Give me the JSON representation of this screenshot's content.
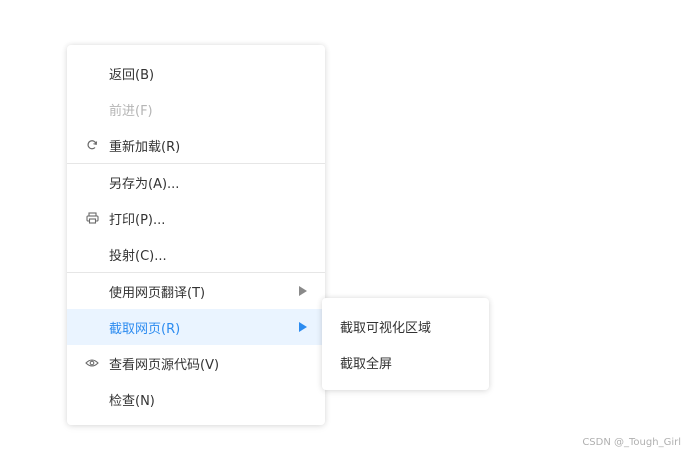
{
  "context_menu": {
    "items": [
      {
        "label": "返回(B)",
        "icon": null,
        "disabled": false
      },
      {
        "label": "前进(F)",
        "icon": null,
        "disabled": true
      },
      {
        "label": "重新加载(R)",
        "icon": "reload-icon",
        "disabled": false
      },
      {
        "label": "另存为(A)...",
        "icon": null,
        "disabled": false
      },
      {
        "label": "打印(P)...",
        "icon": "printer-icon",
        "disabled": false
      },
      {
        "label": "投射(C)...",
        "icon": null,
        "disabled": false
      },
      {
        "label": "使用网页翻译(T)",
        "icon": null,
        "has_submenu": true
      },
      {
        "label": "截取网页(R)",
        "icon": null,
        "has_submenu": true,
        "highlighted": true
      },
      {
        "label": "查看网页源代码(V)",
        "icon": "eye-icon",
        "disabled": false
      },
      {
        "label": "检查(N)",
        "icon": null,
        "disabled": false
      }
    ]
  },
  "submenu": {
    "items": [
      {
        "label": "截取可视化区域"
      },
      {
        "label": "截取全屏"
      }
    ]
  },
  "watermark": "CSDN @_Tough_Girl",
  "colors": {
    "highlight_bg": "#eaf4ff",
    "highlight_text": "#2d8cf0",
    "disabled_text": "#b5b5b5"
  }
}
